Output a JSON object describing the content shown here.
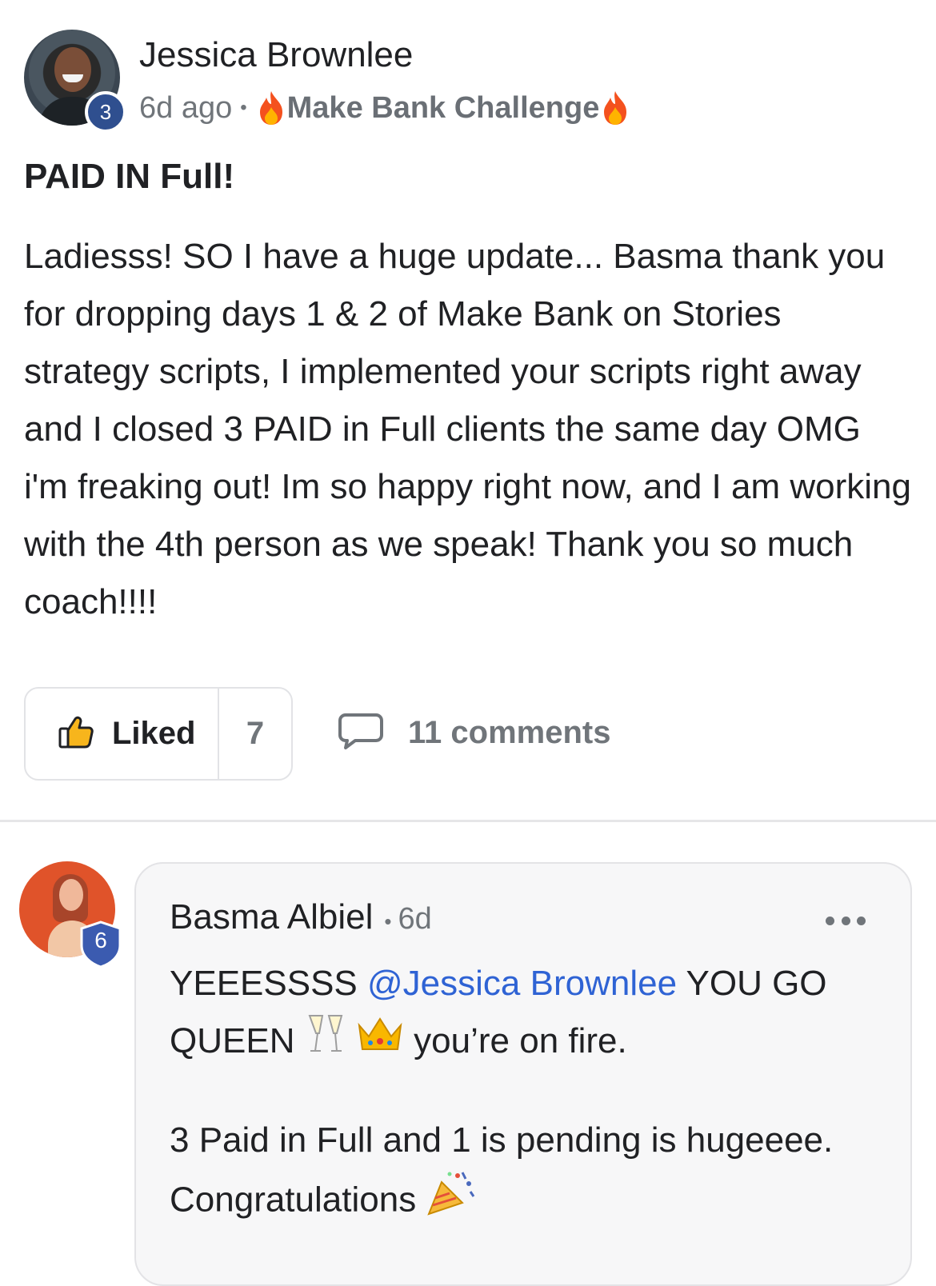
{
  "post": {
    "author": {
      "name": "Jessica Brownlee",
      "level": "3"
    },
    "time": "6d ago",
    "separator": "•",
    "category": "Make Bank Challenge",
    "title": "PAID IN Full!",
    "body": "Ladiesss! SO I have a huge update... Basma thank you for dropping days 1 & 2 of Make Bank on Stories strategy scripts, I implemented your scripts right away and I closed 3 PAID in Full clients the same day OMG i'm freaking out! Im so happy right now, and I am working with the 4th person as we speak! Thank you so much coach!!!!",
    "like": {
      "label": "Liked",
      "count": "7"
    },
    "comments_label": "11 comments"
  },
  "comment": {
    "author": {
      "name": "Basma Albiel",
      "level": "6"
    },
    "separator": "•",
    "time": "6d",
    "text_before_mention": "YEEESSSS ",
    "mention": "@Jessica Brownlee",
    "text_after_mention": " YOU GO QUEEN ",
    "text_end": " you’re on fire.",
    "paragraph2": "3 Paid in Full and 1 is pending is hugeeee. Congratulations "
  },
  "icons": {
    "fire": "fire-emoji-icon",
    "thumbs_up": "thumbs-up-icon",
    "comment": "speech-bubble-icon",
    "more": "more-options-icon",
    "glasses": "clinking-glasses-emoji-icon",
    "crown": "crown-emoji-icon",
    "party": "party-popper-emoji-icon"
  },
  "colors": {
    "mention": "#2f63d4",
    "level_badge": "#2f4f8f",
    "muted_text": "#70757a"
  }
}
